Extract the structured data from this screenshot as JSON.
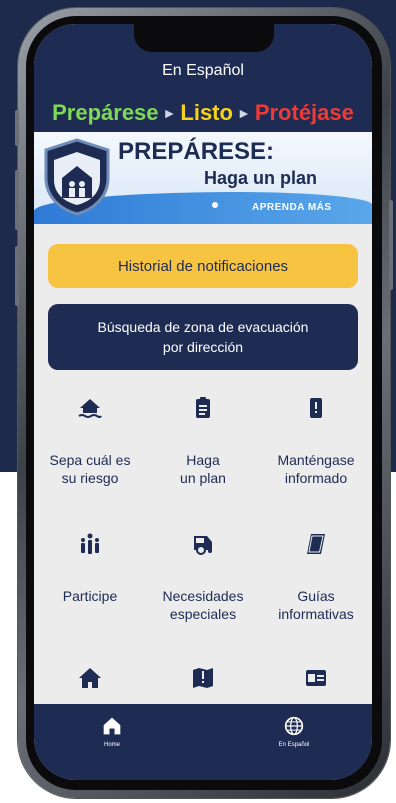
{
  "header": {
    "title": "En Español"
  },
  "banner": {
    "tagline": {
      "part1": "Prepárese",
      "part2": "Listo",
      "part3": "Protéjase"
    },
    "heading": "PREPÁRESE:",
    "subheading": "Haga un plan",
    "link": "APRENDA MÁS"
  },
  "buttons": {
    "notifications": "Historial de notificaciones",
    "evacuation_line1": "Búsqueda de zona de evacuación",
    "evacuation_line2": "por dirección"
  },
  "grid": [
    {
      "line1": "Sepa cuál es",
      "line2": "su riesgo",
      "icon": "house-flood-icon"
    },
    {
      "line1": "Haga",
      "line2": "un plan",
      "icon": "clipboard-icon"
    },
    {
      "line1": "Manténgase",
      "line2": "informado",
      "icon": "phone-alert-icon"
    },
    {
      "line1": "",
      "line2": "Participe",
      "icon": "people-icon"
    },
    {
      "line1": "Necesidades",
      "line2": "especiales",
      "icon": "accessible-vehicle-icon"
    },
    {
      "line1": "Guías",
      "line2": "informativas",
      "icon": "book-icon"
    }
  ],
  "grid_row3_icons": [
    "home-icon",
    "map-alert-icon",
    "id-card-icon"
  ],
  "nav": {
    "home": "Home",
    "spanish": "En Español"
  },
  "colors": {
    "navy": "#1e2b53",
    "yellow": "#f6c441",
    "screen_bg": "#ececec"
  }
}
